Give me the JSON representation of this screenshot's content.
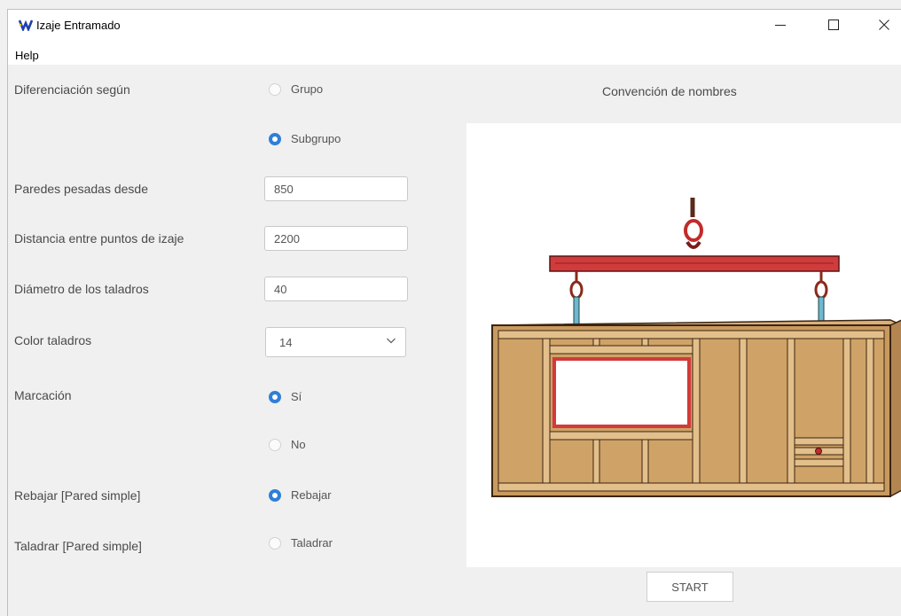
{
  "window": {
    "title": "Izaje Entramado"
  },
  "menu": {
    "help": "Help"
  },
  "form": {
    "diferenciacion": {
      "label": "Diferenciación según",
      "options": [
        "Grupo",
        "Subgrupo"
      ],
      "selected": "Subgrupo"
    },
    "paredes_pesadas": {
      "label": "Paredes pesadas desde",
      "value": "850"
    },
    "distancia": {
      "label": "Distancia entre puntos de izaje",
      "value": "2200"
    },
    "diametro": {
      "label": "Diámetro de los taladros",
      "value": "40"
    },
    "color": {
      "label": "Color taladros",
      "value": "14"
    },
    "marcacion": {
      "label": "Marcación",
      "options": [
        "Sí",
        "No"
      ],
      "selected": "Sí"
    },
    "rebajar": {
      "label": "Rebajar [Pared simple]",
      "option": "Rebajar",
      "checked": true
    },
    "taladrar": {
      "label": "Taladrar [Pared simple]",
      "option": "Taladrar",
      "checked": false
    }
  },
  "preview": {
    "heading": "Convención de nombres"
  },
  "actions": {
    "start": "START"
  },
  "icons": {
    "app": "app-logo-icon",
    "minimize": "minimize-icon",
    "maximize": "maximize-icon",
    "close": "close-icon",
    "chevron": "chevron-down-icon"
  },
  "colors": {
    "accent": "#2f7fd8",
    "beam": "#d03b3b",
    "wood": "#e0b77c",
    "window_frame": "#d33a3a"
  }
}
